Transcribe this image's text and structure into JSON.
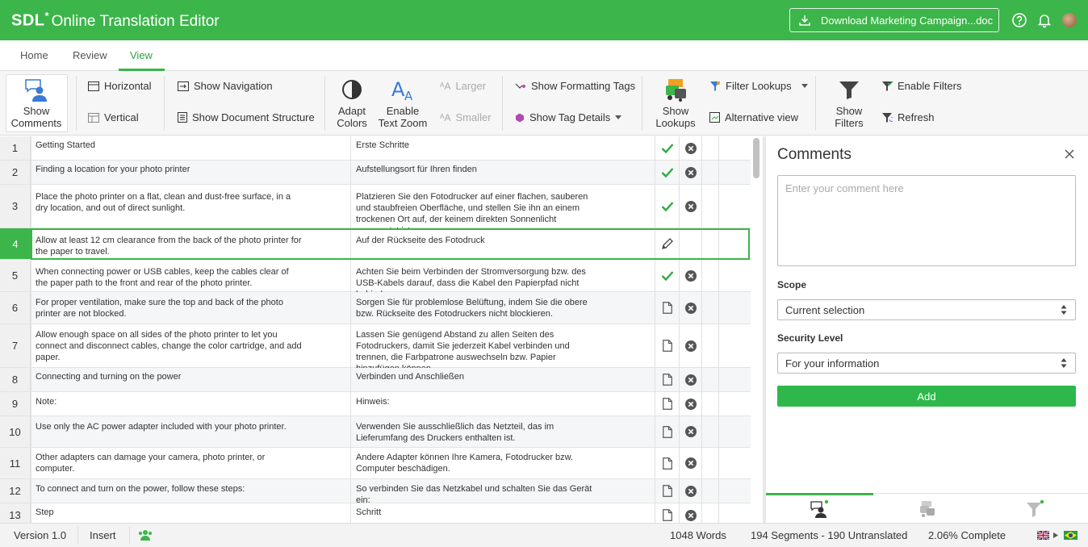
{
  "header": {
    "logo_brand": "SDL",
    "logo_star": "*",
    "app_title": "Online Translation Editor",
    "download_label": "Download Marketing Campaign...doc",
    "icons": [
      "download-icon",
      "help-icon",
      "bell-icon",
      "avatar"
    ]
  },
  "tabs": [
    {
      "label": "Home"
    },
    {
      "label": "Review"
    },
    {
      "label": "View",
      "active": true
    }
  ],
  "ribbon": {
    "show_comments": "Show Comments",
    "horizontal": "Horizontal",
    "vertical": "Vertical",
    "show_navigation": "Show Navigation",
    "show_document_structure": "Show Document Structure",
    "adapt_colors": "Adapt Colors",
    "enable_text_zoom": "Enable Text Zoom",
    "larger": "Larger",
    "smaller": "Smaller",
    "show_formatting_tags": "Show Formatting Tags",
    "show_tag_details": "Show Tag Details",
    "show_lookups": "Show Lookups",
    "filter_lookups": "Filter Lookups",
    "alternative_view": "Alternative view",
    "show_filters": "Show Filters",
    "enable_filters": "Enable Filters",
    "refresh": "Refresh"
  },
  "segments": [
    {
      "n": "1",
      "src": "Getting Started",
      "tgt": "Erste Schritte",
      "status": "confirmed"
    },
    {
      "n": "2",
      "src": "Finding a location for your photo printer",
      "tgt": "Aufstellungsort für Ihren  finden",
      "status": "confirmed"
    },
    {
      "n": "3",
      "src": "Place the photo printer on a flat, clean and dust-free surface, in a dry location, and out of direct sunlight.",
      "tgt": "Platzieren Sie den Fotodrucker auf einer flachen, sauberen und staubfreien Oberfläche, und stellen Sie ihn an einem trockenen Ort auf, der keinem direkten Sonnenlicht ausgesetzt ist.",
      "status": "confirmed"
    },
    {
      "n": "4",
      "src": "Allow at least 12 cm clearance from the back of the photo printer for the paper to travel.",
      "tgt": "Auf der Rückseite des Fotodruck",
      "status": "editing"
    },
    {
      "n": "5",
      "src": "When connecting power or USB cables, keep the cables clear of the paper path to the front and rear of the photo printer.",
      "tgt": "Achten Sie beim Verbinden der Stromversorgung bzw. des USB-Kabels darauf, dass die Kabel den Papierpfad nicht behindern.",
      "status": "confirmed"
    },
    {
      "n": "6",
      "src": "For proper ventilation, make sure the top and back of the photo printer are not blocked.",
      "tgt": "Sorgen Sie für problemlose Belüftung, indem Sie die obere bzw. Rückseite des Fotodruckers nicht blockieren.",
      "status": "draft"
    },
    {
      "n": "7",
      "src": "Allow enough space on all sides of the photo printer to let you connect and disconnect cables, change the color cartridge, and add paper.",
      "tgt": "Lassen Sie genügend Abstand zu allen Seiten des Fotodruckers, damit Sie jederzeit Kabel verbinden und trennen, die Farbpatrone auswechseln bzw. Papier hinzufügen können.",
      "status": "draft"
    },
    {
      "n": "8",
      "src": "Connecting and turning on the power",
      "tgt": " Verbinden und Anschließen",
      "status": "draft"
    },
    {
      "n": "9",
      "src": "Note:",
      "tgt": " Hinweis:",
      "status": "draft"
    },
    {
      "n": "10",
      "src": "Use only the AC power adapter included with your photo printer.",
      "tgt": " Verwenden Sie ausschließlich das Netzteil, das im Lieferumfang des Druckers enthalten ist.",
      "status": "draft"
    },
    {
      "n": "11",
      "src": "Other adapters can damage your camera, photo printer, or computer.",
      "tgt": "Andere Adapter können Ihre Kamera, Fotodrucker bzw. Computer beschädigen.",
      "status": "draft"
    },
    {
      "n": "12",
      "src": "To connect and turn on the power, follow these steps:",
      "tgt": " So verbinden Sie das Netzkabel und schalten Sie das Gerät ein:",
      "status": "draft"
    },
    {
      "n": "13",
      "src": "Step",
      "tgt": "Schritt",
      "status": "draft"
    }
  ],
  "comments_panel": {
    "title": "Comments",
    "placeholder": "Enter your comment here",
    "scope_label": "Scope",
    "scope_value": "Current selection",
    "security_label": "Security Level",
    "security_value": "For your information",
    "add_label": "Add"
  },
  "statusbar": {
    "version": "Version 1.0",
    "mode": "Insert",
    "words": "1048 Words",
    "segments": "194 Segments - 190 Untranslated",
    "complete": "2.06% Complete"
  },
  "colors": {
    "brand": "#3cb54a",
    "check": "#2eaa44",
    "x": "#555555"
  }
}
